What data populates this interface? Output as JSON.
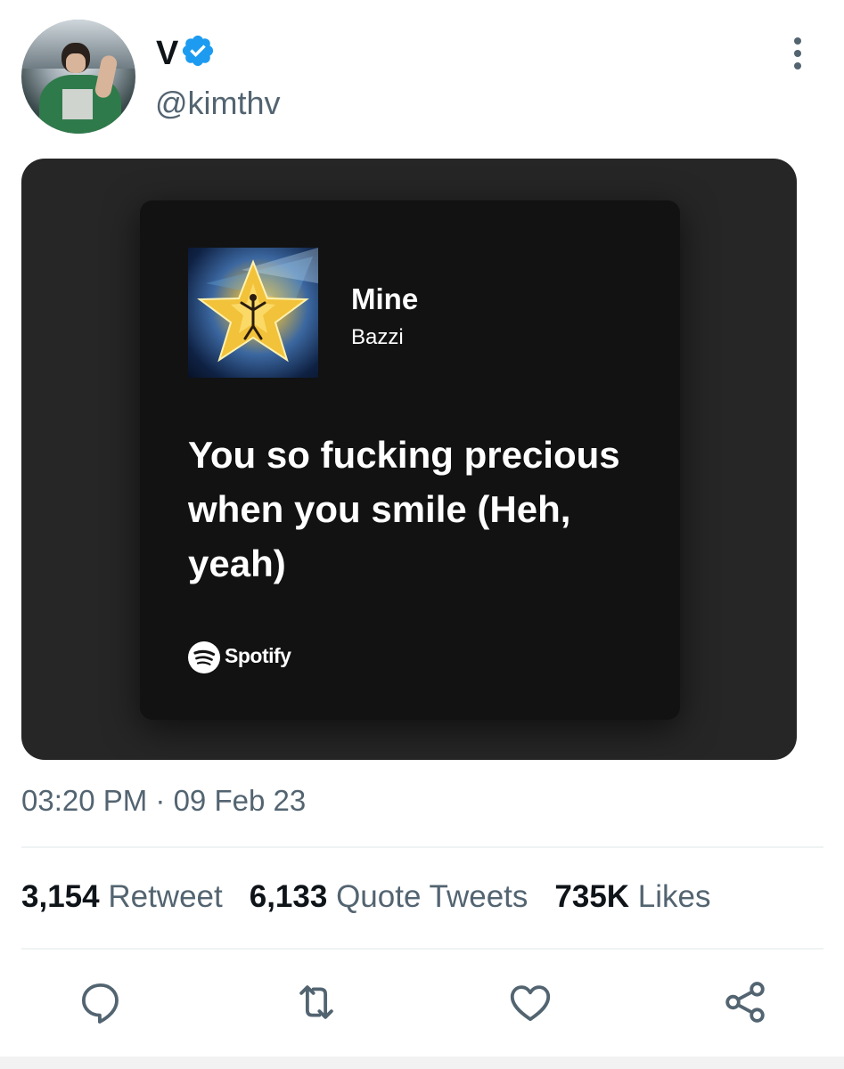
{
  "tweet": {
    "author_name": "V",
    "author_handle": "@kimthv",
    "timestamp": "03:20 PM · 09 Feb 23"
  },
  "spotify_card": {
    "song_title": "Mine",
    "artist": "Bazzi",
    "lyric": "You so fucking precious when you smile (Heh, yeah)",
    "brand": "Spotify"
  },
  "stats": {
    "retweets_count": "3,154",
    "retweets_label": "Retweet",
    "quotes_count": "6,133",
    "quotes_label": "Quote Tweets",
    "likes_count": "735K",
    "likes_label": "Likes"
  },
  "actions": [
    "reply-icon",
    "retweet-icon",
    "like-icon",
    "share-icon"
  ],
  "colors": {
    "verified_blue": "#1d9bf0",
    "secondary_text": "#536471",
    "card_background": "#121212",
    "media_background": "#262626"
  }
}
